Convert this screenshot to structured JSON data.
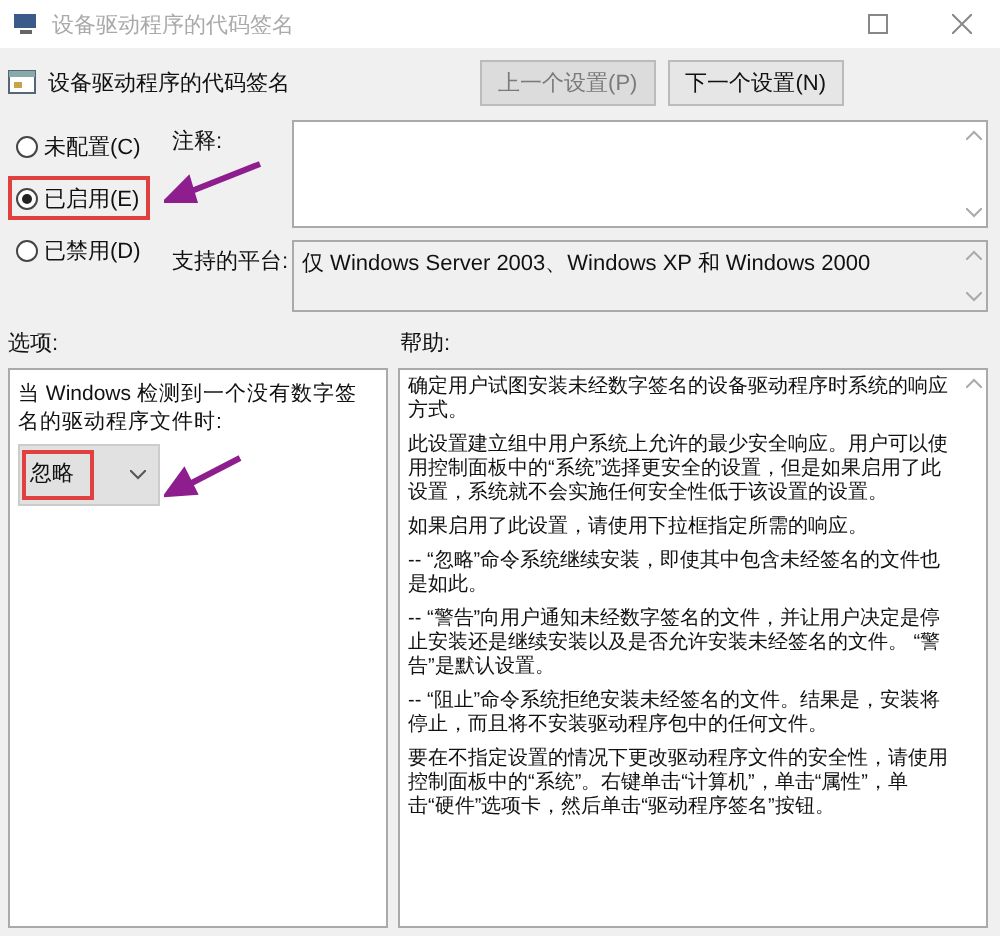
{
  "window": {
    "title": "设备驱动程序的代码签名"
  },
  "header": {
    "title": "设备驱动程序的代码签名",
    "buttons": [
      {
        "label": "上一个设置(P)",
        "disabled": true
      },
      {
        "label": "下一个设置(N)",
        "disabled": false
      }
    ]
  },
  "state_options": [
    {
      "label": "未配置(C)",
      "selected": false
    },
    {
      "label": "已启用(E)",
      "selected": true
    },
    {
      "label": "已禁用(D)",
      "selected": false
    }
  ],
  "comment": {
    "label": "注释:"
  },
  "platform": {
    "label": "支持的平台:",
    "value": "仅 Windows Server 2003、Windows XP 和 Windows 2000"
  },
  "options": {
    "label": "选项:",
    "prompt": "当 Windows 检测到一个没有数字签名的驱动程序文件时:",
    "dropdown": {
      "value": "忽略"
    }
  },
  "help": {
    "label": "帮助:",
    "paragraphs": [
      "确定用户试图安装未经数字签名的设备驱动程序时系统的响应方式。",
      "此设置建立组中用户系统上允许的最少安全响应。用户可以使用控制面板中的“系统”选择更安全的设置，但是如果启用了此设置，系统就不会实施任何安全性低于该设置的设置。",
      "如果启用了此设置，请使用下拉框指定所需的响应。",
      "-- “忽略”命令系统继续安装，即使其中包含未经签名的文件也是如此。",
      "-- “警告”向用户通知未经数字签名的文件，并让用户决定是停止安装还是继续安装以及是否允许安装未经签名的文件。 “警告”是默认设置。",
      "-- “阻止”命令系统拒绝安装未经签名的文件。结果是，安装将停止，而且将不安装驱动程序包中的任何文件。",
      "要在不指定设置的情况下更改驱动程序文件的安全性，请使用控制面板中的“系统”。右键单击“计算机”，单击“属性”，单击“硬件”选项卡，然后单击“驱动程序签名”按钮。"
    ]
  }
}
